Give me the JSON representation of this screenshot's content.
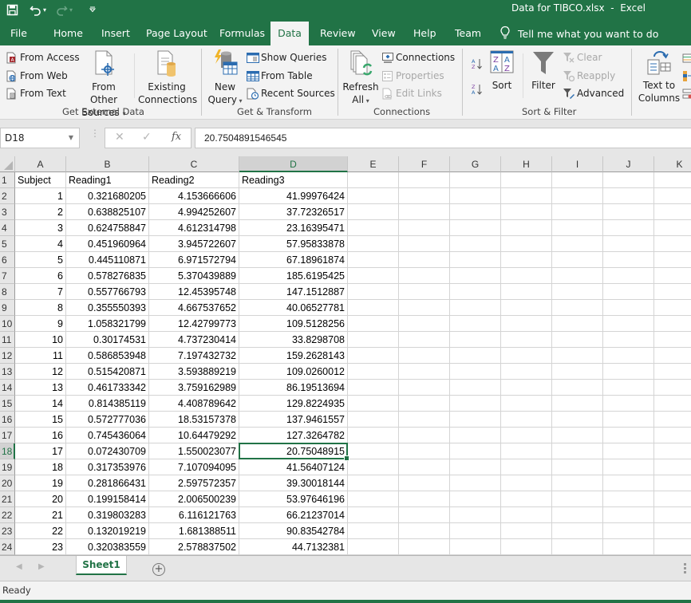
{
  "window": {
    "title": "Data for TIBCO.xlsx  -  Excel"
  },
  "quick_access": {
    "save_icon": "save-icon",
    "undo_icon": "undo-icon",
    "redo_icon": "redo-icon",
    "customize_icon": "customize-qat-icon"
  },
  "tabs": [
    {
      "label": "File"
    },
    {
      "label": "Home"
    },
    {
      "label": "Insert"
    },
    {
      "label": "Page Layout"
    },
    {
      "label": "Formulas"
    },
    {
      "label": "Data",
      "active": true
    },
    {
      "label": "Review"
    },
    {
      "label": "View"
    },
    {
      "label": "Help"
    },
    {
      "label": "Team"
    }
  ],
  "tell_me": {
    "placeholder": "Tell me what you want to do",
    "icon": "lightbulb-icon"
  },
  "ribbon": {
    "get_external_data": {
      "label": "Get External Data",
      "from_access": "From Access",
      "from_web": "From Web",
      "from_text": "From Text",
      "from_other_sources_line1": "From Other",
      "from_other_sources_line2": "Sources",
      "existing_connections_line1": "Existing",
      "existing_connections_line2": "Connections"
    },
    "get_transform": {
      "label": "Get & Transform",
      "new_query_line1": "New",
      "new_query_line2": "Query",
      "show_queries": "Show Queries",
      "from_table": "From Table",
      "recent_sources": "Recent Sources"
    },
    "connections": {
      "label": "Connections",
      "refresh_all_line1": "Refresh",
      "refresh_all_line2": "All",
      "connections": "Connections",
      "properties": "Properties",
      "edit_links": "Edit Links"
    },
    "sort_filter": {
      "label": "Sort & Filter",
      "sort": "Sort",
      "filter": "Filter",
      "clear": "Clear",
      "reapply": "Reapply",
      "advanced": "Advanced"
    },
    "data_tools": {
      "text_to_columns_line1": "Text to",
      "text_to_columns_line2": "Columns"
    }
  },
  "formula_bar": {
    "name_box": "D18",
    "cancel_icon": "cancel-icon",
    "enter_icon": "enter-icon",
    "fx_label": "fx",
    "value": "20.7504891546545"
  },
  "sheet": {
    "columns": [
      "A",
      "B",
      "C",
      "D",
      "E",
      "F",
      "G",
      "H",
      "I",
      "J",
      "K"
    ],
    "selected_column": "D",
    "selected_row": 18,
    "active_cell": "D18",
    "header_row": [
      "Subject",
      "Reading1",
      "Reading2",
      "Reading3"
    ],
    "rows": [
      [
        "1",
        "0.321680205",
        "4.153666606",
        "41.99976424"
      ],
      [
        "2",
        "0.638825107",
        "4.994252607",
        "37.72326517"
      ],
      [
        "3",
        "0.624758847",
        "4.612314798",
        "23.16395471"
      ],
      [
        "4",
        "0.451960964",
        "3.945722607",
        "57.95833878"
      ],
      [
        "5",
        "0.445110871",
        "6.971572794",
        "67.18961874"
      ],
      [
        "6",
        "0.578276835",
        "5.370439889",
        "185.6195425"
      ],
      [
        "7",
        "0.557766793",
        "12.45395748",
        "147.1512887"
      ],
      [
        "8",
        "0.355550393",
        "4.667537652",
        "40.06527781"
      ],
      [
        "9",
        "1.058321799",
        "12.42799773",
        "109.5128256"
      ],
      [
        "10",
        "0.30174531",
        "4.737230414",
        "33.8298708"
      ],
      [
        "11",
        "0.586853948",
        "7.197432732",
        "159.2628143"
      ],
      [
        "12",
        "0.515420871",
        "3.593889219",
        "109.0260012"
      ],
      [
        "13",
        "0.461733342",
        "3.759162989",
        "86.19513694"
      ],
      [
        "14",
        "0.814385119",
        "4.408789642",
        "129.8224935"
      ],
      [
        "15",
        "0.572777036",
        "18.53157378",
        "137.9461557"
      ],
      [
        "16",
        "0.745436064",
        "10.64479292",
        "127.3264782"
      ],
      [
        "17",
        "0.072430709",
        "1.550023077",
        "20.75048915"
      ],
      [
        "18",
        "0.317353976",
        "7.107094095",
        "41.56407124"
      ],
      [
        "19",
        "0.281866431",
        "2.597572357",
        "39.30018144"
      ],
      [
        "20",
        "0.199158414",
        "2.006500239",
        "53.97646196"
      ],
      [
        "21",
        "0.319803283",
        "6.116121763",
        "66.21237014"
      ],
      [
        "22",
        "0.132019219",
        "1.681388511",
        "90.83542784"
      ],
      [
        "23",
        "0.320383559",
        "2.578837502",
        "44.7132381"
      ]
    ]
  },
  "sheet_tabs": [
    {
      "label": "Sheet1",
      "active": true
    }
  ],
  "add_sheet_icon": "add-sheet-icon",
  "status": {
    "text": "Ready"
  },
  "colors": {
    "accent": "#217346",
    "ribbon_bg": "#f3f3f3",
    "grid_line": "#d4d4d4"
  }
}
